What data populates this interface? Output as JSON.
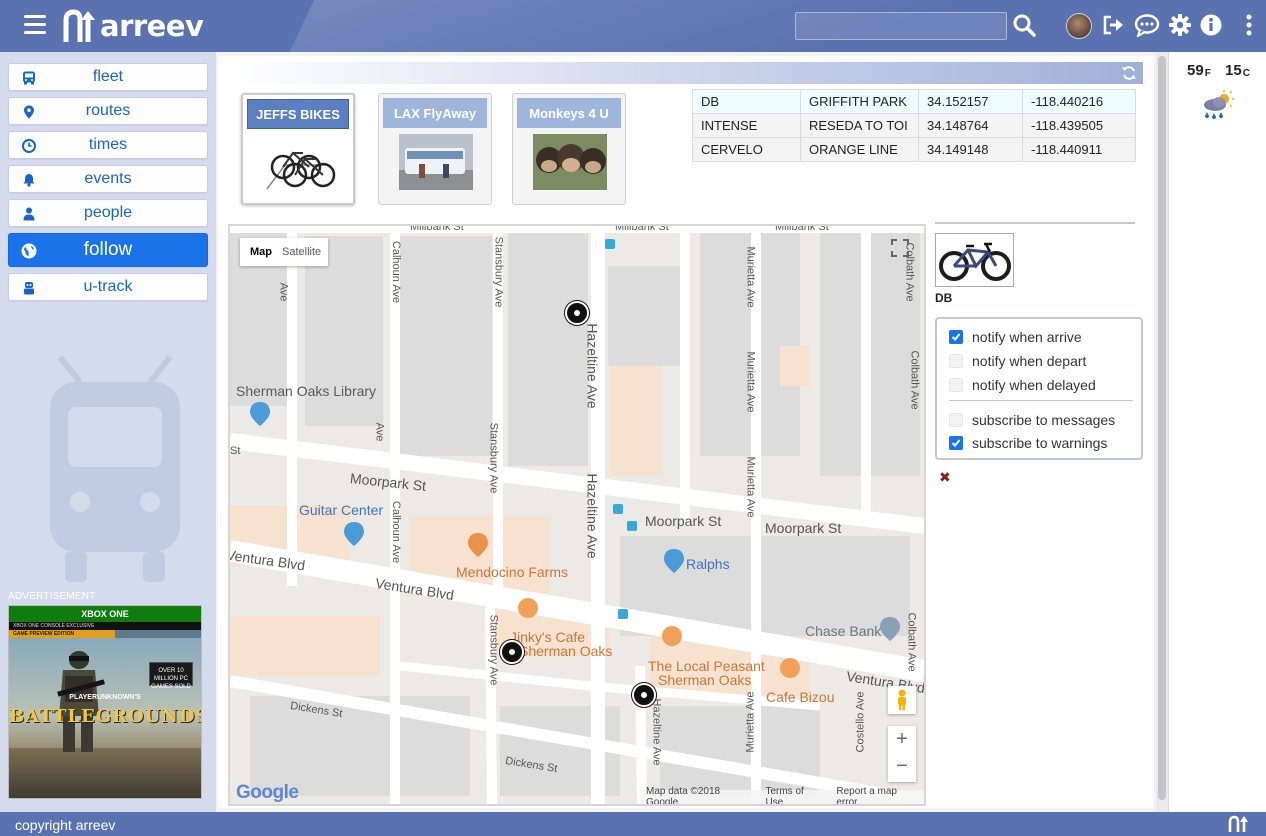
{
  "header": {
    "app_name": "arreev",
    "search": {
      "value": "",
      "placeholder": ""
    },
    "icons": [
      "menu-icon",
      "search-icon",
      "avatar",
      "signout-icon",
      "chat-icon",
      "gear-icon",
      "info-icon",
      "more-vertical-icon"
    ]
  },
  "sidebar": {
    "items": [
      {
        "label": "fleet",
        "icon": "bus-icon"
      },
      {
        "label": "routes",
        "icon": "pin-icon"
      },
      {
        "label": "times",
        "icon": "clock-icon"
      },
      {
        "label": "events",
        "icon": "bell-icon"
      },
      {
        "label": "people",
        "icon": "person-icon"
      },
      {
        "label": "follow",
        "icon": "globe-icon",
        "active": true
      },
      {
        "label": "u-track",
        "icon": "robot-icon"
      }
    ],
    "ad": {
      "label": "ADVERTISEMENT",
      "brand": "XBOX ONE",
      "strip": "XBOX ONE CONSOLE EXCLUSIVE",
      "edition": "GAME PREVIEW EDITION",
      "title": "BATTLEGROUNDS",
      "subtitle": "PLAYERUNKNOWN'S",
      "badge": "OVER 10 MILLION PC GAMES SOLD"
    }
  },
  "fleets": [
    {
      "name": "JEFFS BIKES",
      "selected": true,
      "image": "bikes-image"
    },
    {
      "name": "LAX FlyAway",
      "selected": false,
      "image": "bus-image"
    },
    {
      "name": "Monkeys 4 U",
      "selected": false,
      "image": "monkeys-image"
    }
  ],
  "units": [
    {
      "name": "DB",
      "route": "GRIFFITH PARK",
      "lat": "34.152157",
      "lng": "-118.440216",
      "selected": true
    },
    {
      "name": "INTENSE",
      "route": "RESEDA TO TOI",
      "lat": "34.148764",
      "lng": "-118.439505",
      "selected": false
    },
    {
      "name": "CERVELO",
      "route": "ORANGE LINE",
      "lat": "34.149148",
      "lng": "-118.440911",
      "selected": false
    }
  ],
  "map": {
    "type_buttons": [
      "Map",
      "Satellite"
    ],
    "streets": {
      "millbank": "Millbank St",
      "calhoun": "Calhoun Ave",
      "stansbury": "Stansbury Ave",
      "hazeltine": "Hazeltine Ave",
      "murietta": "Murietta Ave",
      "colbath": "Colbath Ave",
      "moorpark": "Moorpark St",
      "ventura": "Ventura Blvd",
      "dickens": "Dickens St",
      "costello": "Costello Ave",
      "st": "St",
      "ave": "Ave"
    },
    "places": {
      "library": "Sherman Oaks Library",
      "guitar_center": "Guitar Center",
      "mendocino": "Mendocino Farms",
      "ralphs": "Ralphs",
      "chase": "Chase Bank",
      "jinkys_1": "Jinky's Cafe",
      "jinkys_2": "Sherman Oaks",
      "peasant_1": "The Local Peasant",
      "peasant_2": "Sherman Oaks",
      "bizou": "Cafe Bizou"
    },
    "footer": {
      "google": "Google",
      "data": "Map data ©2018 Google",
      "terms": "Terms of Use",
      "report": "Report a map error"
    },
    "controls": {
      "zoom_in": "+",
      "zoom_out": "−"
    }
  },
  "detail": {
    "name": "DB",
    "options": [
      {
        "label": "notify when arrive",
        "checked": true
      },
      {
        "label": "notify when depart",
        "checked": false
      },
      {
        "label": "notify when delayed",
        "checked": false
      },
      {
        "label": "subscribe to messages",
        "checked": false
      },
      {
        "label": "subscribe to warnings",
        "checked": true
      }
    ]
  },
  "weather": {
    "temp_f": "59",
    "unit_f": "F",
    "temp_c": "15",
    "unit_c": "C",
    "condition_icon": "rain-sun-icon"
  },
  "footer": {
    "copyright": "copyright arreev"
  },
  "colors": {
    "header": "#5b72b0",
    "sidebar": "#d3dbec",
    "accent": "#1a73e8",
    "link": "#1a63c8",
    "close": "#8b1d1d"
  }
}
